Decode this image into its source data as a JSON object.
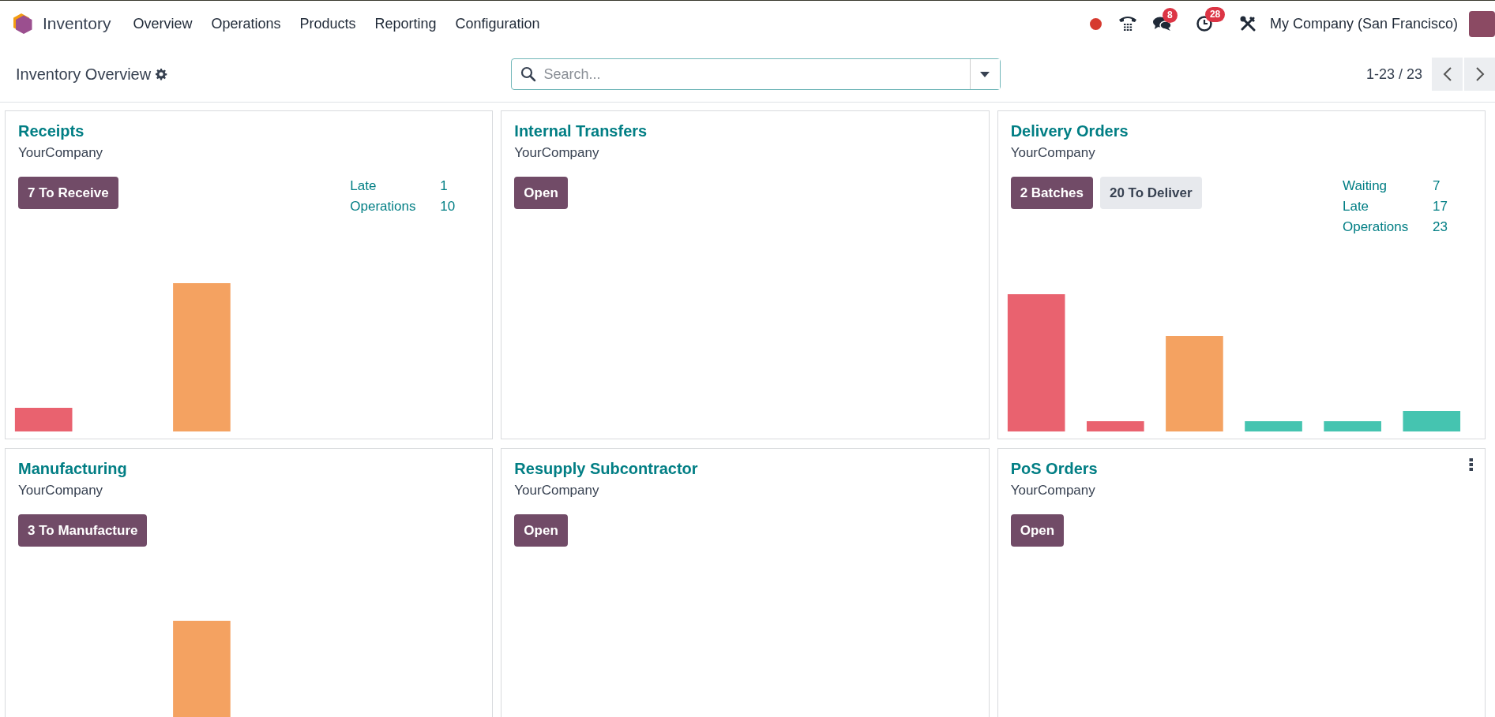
{
  "navbar": {
    "app_name": "Inventory",
    "menu": [
      {
        "label": "Overview"
      },
      {
        "label": "Operations"
      },
      {
        "label": "Products"
      },
      {
        "label": "Reporting"
      },
      {
        "label": "Configuration"
      }
    ],
    "systray": {
      "messages_badge": "8",
      "activities_badge": "28",
      "company": "My Company (San Francisco)"
    }
  },
  "control_panel": {
    "title": "Inventory Overview",
    "search": {
      "placeholder": "Search..."
    },
    "pager": "1-23 / 23"
  },
  "cards": [
    {
      "title": "Receipts",
      "company": "YourCompany",
      "buttons": [
        {
          "label": "7 To Receive",
          "kind": "primary"
        }
      ],
      "stats": [
        {
          "label": "Late",
          "value": "1"
        },
        {
          "label": "Operations",
          "value": "10"
        }
      ],
      "menu": false
    },
    {
      "title": "Internal Transfers",
      "company": "YourCompany",
      "buttons": [
        {
          "label": "Open",
          "kind": "primary"
        }
      ],
      "menu": false
    },
    {
      "title": "Delivery Orders",
      "company": "YourCompany",
      "buttons": [
        {
          "label": "2 Batches",
          "kind": "primary"
        },
        {
          "label": "20 To Deliver",
          "kind": "secondary"
        }
      ],
      "stats": [
        {
          "label": "Waiting",
          "value": "7"
        },
        {
          "label": "Late",
          "value": "17"
        },
        {
          "label": "Operations",
          "value": "23"
        }
      ],
      "menu": false
    },
    {
      "title": "Manufacturing",
      "company": "YourCompany",
      "buttons": [
        {
          "label": "3 To Manufacture",
          "kind": "primary"
        }
      ],
      "menu": false
    },
    {
      "title": "Resupply Subcontractor",
      "company": "YourCompany",
      "buttons": [
        {
          "label": "Open",
          "kind": "primary"
        }
      ],
      "menu": false
    },
    {
      "title": "PoS Orders",
      "company": "YourCompany",
      "buttons": [
        {
          "label": "Open",
          "kind": "primary"
        }
      ],
      "menu": true
    }
  ]
}
